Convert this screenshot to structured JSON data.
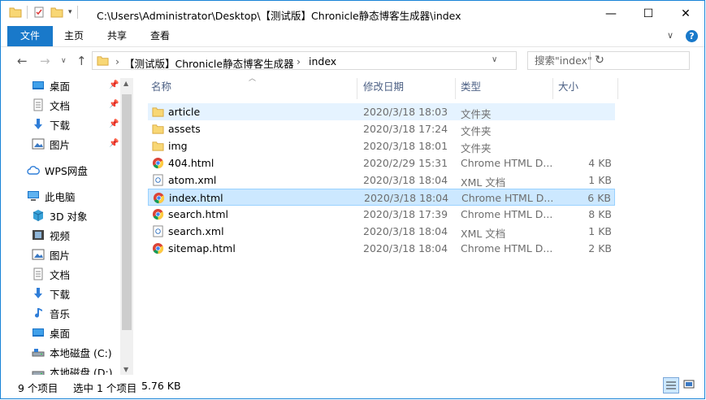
{
  "window": {
    "title": "C:\\Users\\Administrator\\Desktop\\【测试版】Chronicle静态博客生成器\\index",
    "controls": {
      "minimize": "—",
      "maximize": "☐",
      "close": "✕"
    }
  },
  "ribbon": {
    "tabs": [
      "文件",
      "主页",
      "共享",
      "查看"
    ],
    "help": "?",
    "expand": "∨"
  },
  "address": {
    "crumbs": [
      "【测试版】Chronicle静态博客生成器",
      "index"
    ],
    "separator": "›",
    "search_placeholder": "搜索\"index\""
  },
  "nav": {
    "quick_access": [
      {
        "label": "桌面",
        "icon": "desktop-icon"
      },
      {
        "label": "文档",
        "icon": "document-icon"
      },
      {
        "label": "下载",
        "icon": "download-icon"
      },
      {
        "label": "图片",
        "icon": "picture-icon"
      }
    ],
    "wps": {
      "label": "WPS网盘",
      "icon": "cloud-icon"
    },
    "this_pc": {
      "label": "此电脑",
      "icon": "computer-icon"
    },
    "pc_items": [
      {
        "label": "3D 对象",
        "icon": "3d-objects-icon"
      },
      {
        "label": "视频",
        "icon": "video-icon"
      },
      {
        "label": "图片",
        "icon": "picture-icon"
      },
      {
        "label": "文档",
        "icon": "document-icon"
      },
      {
        "label": "下载",
        "icon": "download-icon"
      },
      {
        "label": "音乐",
        "icon": "music-icon"
      },
      {
        "label": "桌面",
        "icon": "desktop-icon"
      },
      {
        "label": "本地磁盘 (C:)",
        "icon": "drive-icon"
      },
      {
        "label": "本地磁盘 (D:)",
        "icon": "drive-icon"
      }
    ]
  },
  "columns": {
    "name": "名称",
    "date": "修改日期",
    "type": "类型",
    "size": "大小"
  },
  "files": [
    {
      "name": "article",
      "date": "2020/3/18 18:03",
      "type": "文件夹",
      "size": "",
      "icon": "folder-icon"
    },
    {
      "name": "assets",
      "date": "2020/3/18 17:24",
      "type": "文件夹",
      "size": "",
      "icon": "folder-icon"
    },
    {
      "name": "img",
      "date": "2020/3/18 18:01",
      "type": "文件夹",
      "size": "",
      "icon": "folder-icon"
    },
    {
      "name": "404.html",
      "date": "2020/2/29 15:31",
      "type": "Chrome HTML D...",
      "size": "4 KB",
      "icon": "chrome-icon"
    },
    {
      "name": "atom.xml",
      "date": "2020/3/18 18:04",
      "type": "XML 文档",
      "size": "1 KB",
      "icon": "xml-icon"
    },
    {
      "name": "index.html",
      "date": "2020/3/18 18:04",
      "type": "Chrome HTML D...",
      "size": "6 KB",
      "icon": "chrome-icon"
    },
    {
      "name": "search.html",
      "date": "2020/3/18 17:39",
      "type": "Chrome HTML D...",
      "size": "8 KB",
      "icon": "chrome-icon"
    },
    {
      "name": "search.xml",
      "date": "2020/3/18 18:04",
      "type": "XML 文档",
      "size": "1 KB",
      "icon": "xml-icon"
    },
    {
      "name": "sitemap.html",
      "date": "2020/3/18 18:04",
      "type": "Chrome HTML D...",
      "size": "2 KB",
      "icon": "chrome-icon"
    }
  ],
  "state": {
    "hover_row": 0,
    "selected_row": 5
  },
  "status": {
    "count": "9 个项目",
    "selected": "选中 1 个项目",
    "size": "5.76 KB"
  },
  "colors": {
    "accent": "#1979ca",
    "folder": "#f8d775",
    "selected_row": "#cce8ff",
    "hover_row": "#e5f3ff"
  }
}
